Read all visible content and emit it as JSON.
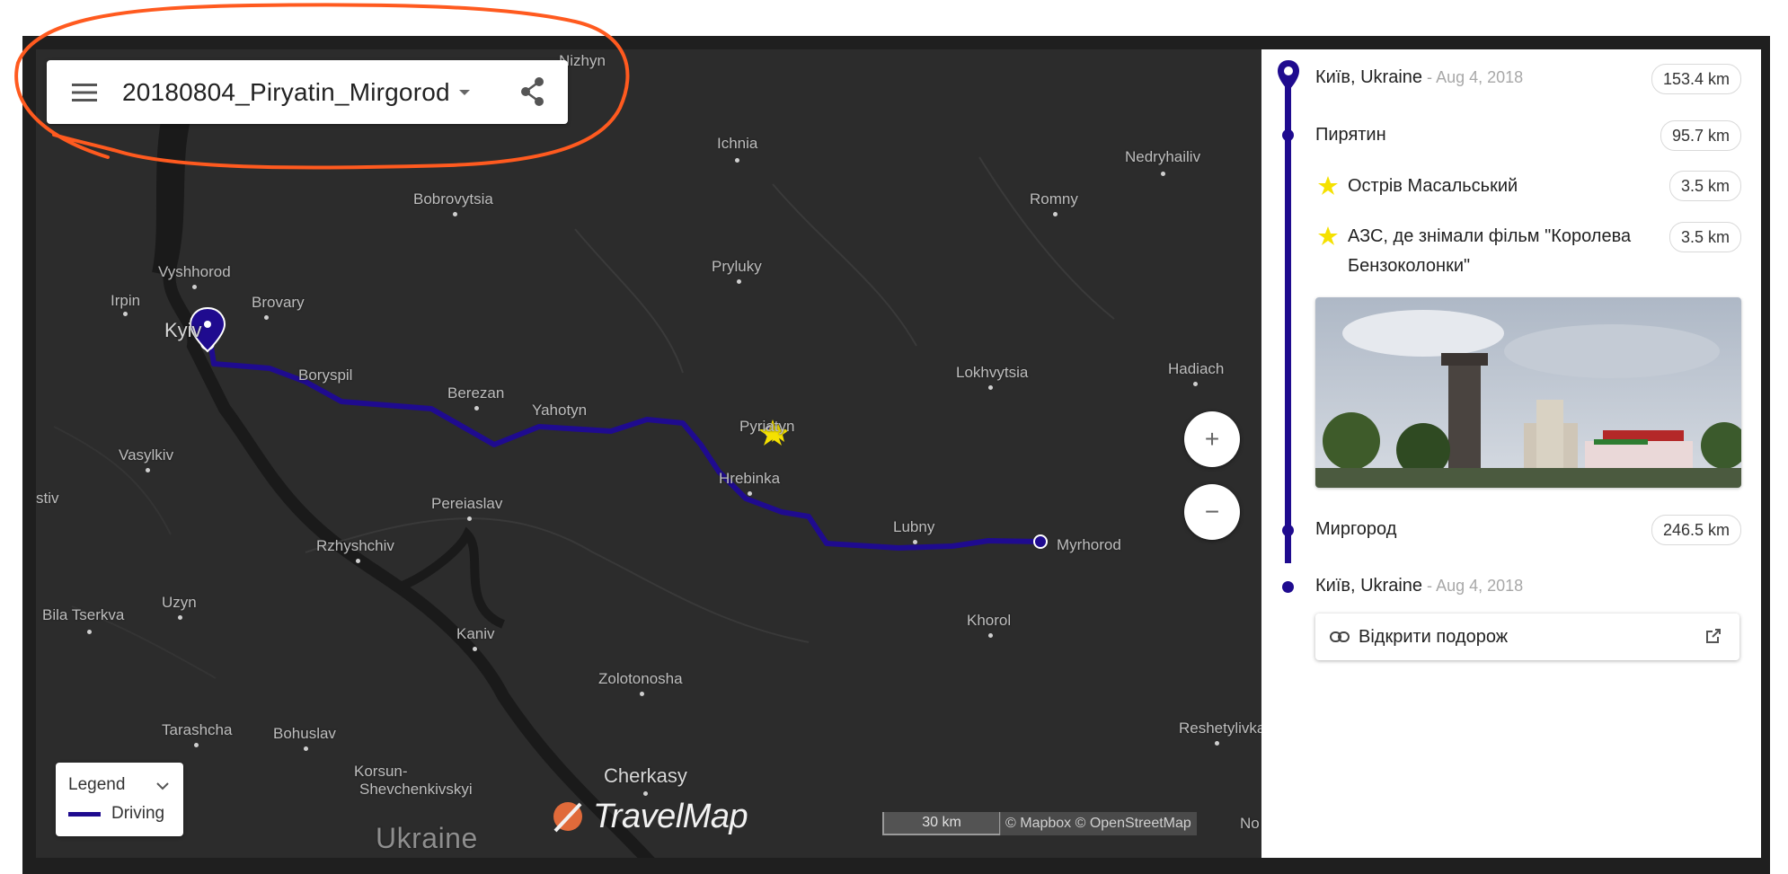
{
  "header": {
    "trip_title": "20180804_Piryatin_Mirgorod",
    "menu_icon": "menu-icon",
    "share_icon": "share-icon"
  },
  "map": {
    "cities": {
      "nizhyn": "Nizhyn",
      "ichnia": "Ichnia",
      "nedryhailiv": "Nedryhailiv",
      "bobrovytsia": "Bobrovytsia",
      "romny": "Romny",
      "vyshhorod": "Vyshhorod",
      "pryluky": "Pryluky",
      "irpin": "Irpin",
      "brovary": "Brovary",
      "kyiv": "Kyiv",
      "boryspil": "Boryspil",
      "lokhvytsia": "Lokhvytsia",
      "hadiach": "Hadiach",
      "berezan": "Berezan",
      "yahotyn": "Yahotyn",
      "pyriatyn": "Pyriatyn",
      "vasylkiv": "Vasylkiv",
      "hrebinka": "Hrebinka",
      "fastiv": "stiv",
      "pereiaslav": "Pereiaslav",
      "lubny": "Lubny",
      "myrhorod": "Myrhorod",
      "rzhyshchiv": "Rzhyshchiv",
      "uzyn": "Uzyn",
      "bila_tserkva": "Bila Tserkva",
      "khorol": "Khorol",
      "kaniv": "Kaniv",
      "zolotonosha": "Zolotonosha",
      "tarashcha": "Tarashcha",
      "bohuslav": "Bohuslav",
      "reshetylivka": "Reshetylivka",
      "korsun": "Korsun-",
      "korsun2": "Shevchenkivskyi",
      "cherkasy": "Cherkasy",
      "country": "Ukraine",
      "nov": "No"
    },
    "zoom_in": "+",
    "zoom_out": "−",
    "scale": "30 km",
    "attribution": "© Mapbox © OpenStreetMap",
    "route_color": "#1f0b8f"
  },
  "legend": {
    "title": "Legend",
    "items": [
      {
        "label": "Driving",
        "color": "#1f0b8f"
      }
    ]
  },
  "brand": {
    "name": "TravelMap",
    "color": "#e06a3a"
  },
  "sidebar": {
    "stops": [
      {
        "name": "Київ, Ukraine",
        "date": "Aug 4, 2018",
        "distance": "153.4 km"
      },
      {
        "name": "Пирятин",
        "distance": "95.7 km"
      },
      {
        "name": "Острів Масальський",
        "distance": "3.5 km"
      },
      {
        "name": "АЗС, де знімали фільм \"Королева",
        "name2": "Бензоколонки\"",
        "distance": "3.5 km"
      },
      {
        "name": "Миргород",
        "distance": "246.5 km"
      },
      {
        "name": "Київ, Ukraine",
        "date": "Aug 4, 2018"
      }
    ],
    "separator": " - ",
    "open_trip": "Відкрити подорож"
  },
  "annotation_color": "#ff5a1f"
}
